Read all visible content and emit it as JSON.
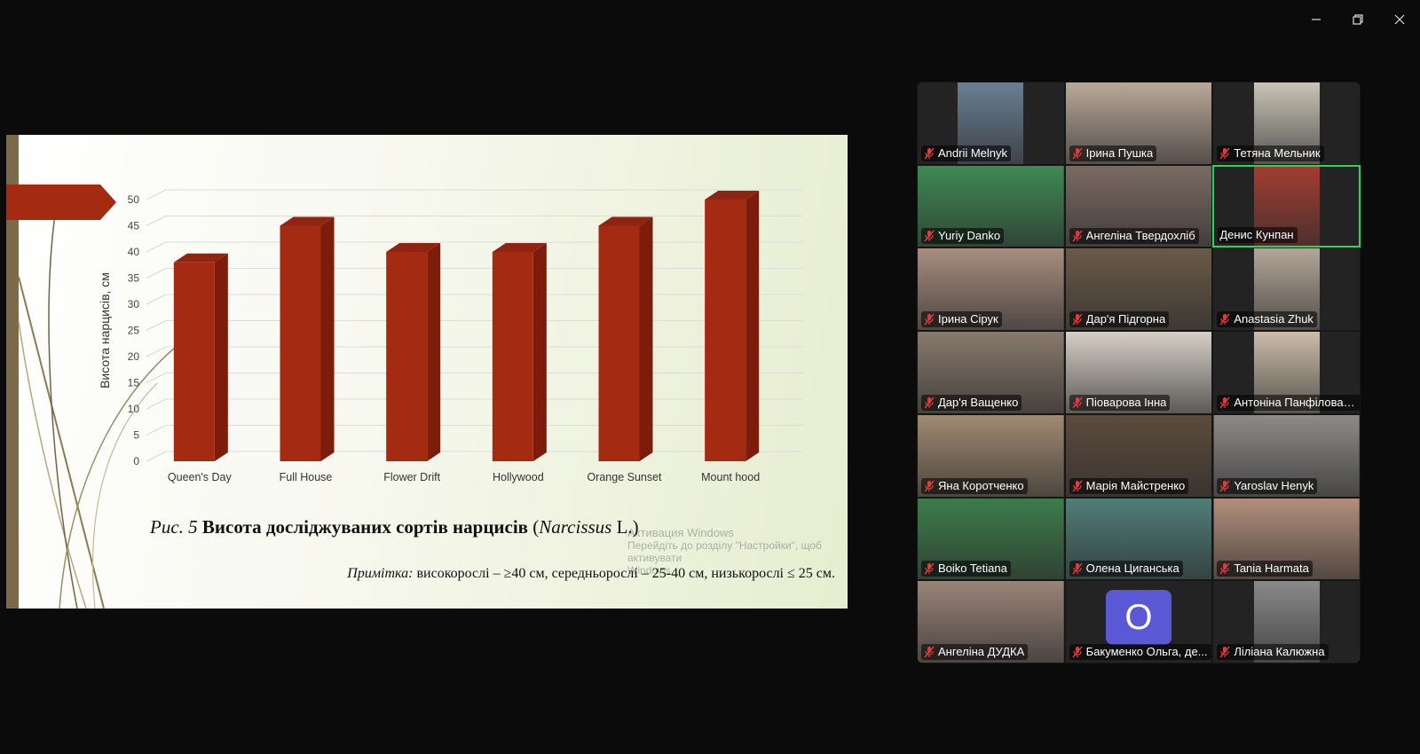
{
  "window": {
    "minimize_icon": "minimize-icon",
    "restore_icon": "restore-icon",
    "close_icon": "close-icon"
  },
  "slide": {
    "caption_prefix_italic": "Рис. 5",
    "caption_bold": "Висота досліджуваних сортів нарцисів",
    "caption_open_paren": " (",
    "caption_latin": "Narcissus",
    "caption_tail": " L.)",
    "note_label": "Примітка:",
    "note_text": " високорослі – ≥40 см, середньорослі  – 25-40 см, низькорослі ≤ 25 см.",
    "watermark_line1": "Активация Windows",
    "watermark_line2": "Перейдіть до розділу \"Настройки\", щоб активувати",
    "watermark_line3": "Windows."
  },
  "chart_data": {
    "type": "bar",
    "categories": [
      "Queen's Day",
      "Full House",
      "Flower Drift",
      "Hollywood",
      "Orange Sunset",
      "Mount hood"
    ],
    "values": [
      38,
      45,
      40,
      40,
      45,
      50
    ],
    "ylabel": "Висота нарцисів, см",
    "ylim": [
      0,
      50
    ],
    "yticks": [
      0,
      5,
      10,
      15,
      20,
      25,
      30,
      35,
      40,
      45,
      50
    ],
    "bar_color": "#a52a12",
    "grid": true
  },
  "participants": [
    {
      "name": "Andrii Melnyk",
      "muted": true,
      "photo": "#6a7f93"
    },
    {
      "name": "Ірина Пушка",
      "muted": true,
      "photo": "#b9a898"
    },
    {
      "name": "Тетяна Мельник",
      "muted": true,
      "photo": "#c8c4b6"
    },
    {
      "name": "Yuriy Danko",
      "muted": true,
      "photo": "#3e8a53"
    },
    {
      "name": "Ангеліна Твердохліб",
      "muted": true,
      "photo": "#7b6b62"
    },
    {
      "name": "Денис Кунпан",
      "muted": false,
      "active": true,
      "photo": "#a33c32"
    },
    {
      "name": "Ірина Сірук",
      "muted": true,
      "photo": "#a88e7f"
    },
    {
      "name": "Дар'я Підгорна",
      "muted": true,
      "photo": "#6a5a48"
    },
    {
      "name": "Anastasia Zhuk",
      "muted": true,
      "photo": "#b3a799"
    },
    {
      "name": "Дар'я Ващенко",
      "muted": true,
      "photo": "#887a6c"
    },
    {
      "name": "Піоварова Інна",
      "muted": true,
      "photo": "#d6cfc6"
    },
    {
      "name": "Антоніна Панфілова, ...",
      "muted": true,
      "photo": "#cbbda9"
    },
    {
      "name": "Яна Коротченко",
      "muted": true,
      "photo": "#a08a72"
    },
    {
      "name": "Марія Майстренко",
      "muted": true,
      "photo": "#5c4b3d"
    },
    {
      "name": "Yaroslav Henyk",
      "muted": true,
      "photo": "#8e8a88"
    },
    {
      "name": "Boiko Tetiana",
      "muted": true,
      "photo": "#3c7d4a"
    },
    {
      "name": "Олена Циганська",
      "muted": true,
      "photo": "#507e79"
    },
    {
      "name": "Tania Harmata",
      "muted": true,
      "photo": "#b38f7b"
    },
    {
      "name": "Ангеліна ДУДКА",
      "muted": true,
      "photo": "#9a8478"
    },
    {
      "name": "Бакуменко Ольга,  де...",
      "muted": true,
      "avatar_letter": "O",
      "avatar_color": "#5b58d6"
    },
    {
      "name": "Ліліана Калюжна",
      "muted": true,
      "photo": "#8a8a8a"
    }
  ]
}
